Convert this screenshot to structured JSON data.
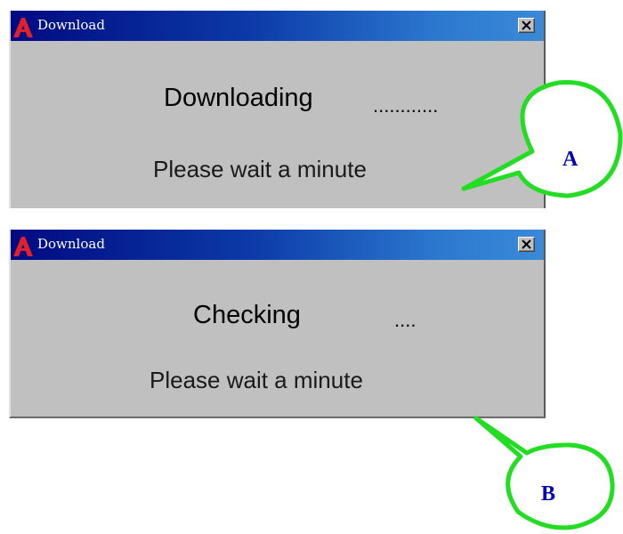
{
  "windows": [
    {
      "title": "Download",
      "status": "Downloading",
      "dots": "............",
      "message": "Please wait a minute"
    },
    {
      "title": "Download",
      "status": "Checking",
      "dots": "....",
      "message": "Please wait a minute"
    }
  ],
  "callouts": {
    "a": "A",
    "b": "B"
  },
  "colors": {
    "callout_outline": "#22dd22",
    "callout_text": "#0000b0",
    "logo": "#e0202a",
    "titlebar_dark": "#000a80",
    "titlebar_light": "#3a8ad8",
    "window_face": "#c0c0c0"
  },
  "icons": {
    "app": "autocad-logo-icon",
    "close": "close-icon"
  }
}
